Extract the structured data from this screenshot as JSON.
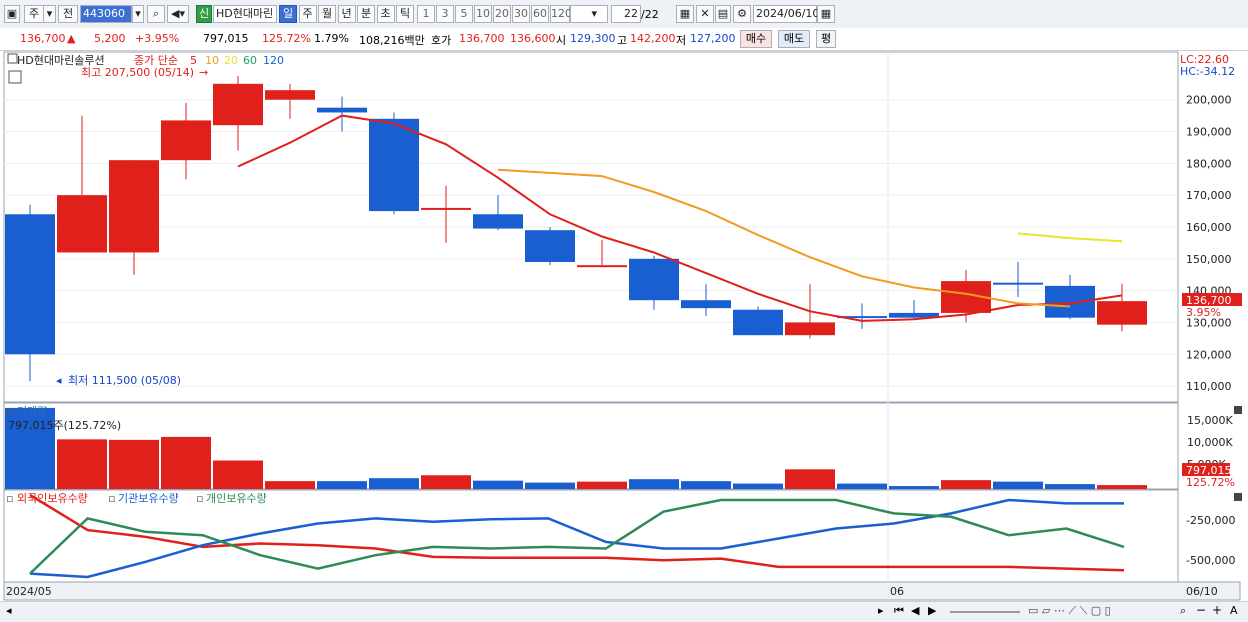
{
  "toolbar": {
    "stock_type": "주",
    "prev_label": "전",
    "code": "443060",
    "new_badge": "신",
    "stock_name": "HD현대마린",
    "periods": [
      "일",
      "주",
      "월",
      "년",
      "분",
      "초",
      "틱"
    ],
    "active_period": "일",
    "intervals": [
      "1",
      "3",
      "5",
      "10",
      "20",
      "30",
      "60",
      "120"
    ],
    "page_count": "22",
    "page_total": "/22",
    "date": "2024/06/10"
  },
  "quote": {
    "price": "136,700",
    "change": "5,200",
    "change_pct": "+3.95%",
    "volume": "797,015",
    "volume_ratio": "125.72%",
    "turnover": "1.79%",
    "amount": "108,216백만",
    "hoga_label": "호가",
    "ask": "136,700",
    "bid": "136,600",
    "open_label": "시",
    "open": "129,300",
    "high_label": "고",
    "high": "142,200",
    "low_label": "저",
    "low": "127,200",
    "buy_label": "매수",
    "sell_label": "매도",
    "avg_label": "평"
  },
  "price_chart": {
    "title": "HD현대마린솔루션",
    "ma_label": "종가 단순",
    "ma_periods": [
      "5",
      "10",
      "20",
      "60",
      "120"
    ],
    "ma_colors": [
      "#e0201b",
      "#f29a1f",
      "#e6e62a",
      "#2a9d5c",
      "#1a5fd1"
    ],
    "lc": "LC:22.60",
    "hc": "HC:-34.12",
    "high_note": "최고 207,500 (05/14)",
    "low_note": "최저 111,500 (05/08)",
    "last_price_tag": "136,700",
    "last_pct_tag": "3.95%",
    "y_ticks": [
      "200,000",
      "190,000",
      "180,000",
      "170,000",
      "160,000",
      "150,000",
      "140,000",
      "130,000",
      "120,000",
      "110,000"
    ]
  },
  "volume_chart": {
    "title": "거래량",
    "note": "797,015주(125.72%)",
    "y_ticks": [
      "15,000K",
      "10,000K",
      "5,000K"
    ],
    "last_tag": "797,015",
    "last_pct_tag": "125.72%"
  },
  "holdings_chart": {
    "legend": [
      "외국인보유수량",
      "기관보유수량",
      "개인보유수량"
    ],
    "colors": [
      "#e0201b",
      "#1a5fd1",
      "#2e8b57"
    ],
    "y_ticks": [
      "-250,000",
      "-500,000"
    ]
  },
  "x_axis": {
    "start": "2024/05",
    "mid": "06",
    "end": "06/10"
  },
  "chart_data": {
    "type": "candlestick",
    "y_range": [
      105000,
      215000
    ],
    "candles": [
      {
        "o": 164000,
        "h": 167000,
        "l": 111500,
        "c": 120000
      },
      {
        "o": 152000,
        "h": 195000,
        "l": 152000,
        "c": 170000
      },
      {
        "o": 152000,
        "h": 181000,
        "l": 145000,
        "c": 181000
      },
      {
        "o": 181000,
        "h": 199000,
        "l": 175000,
        "c": 193500
      },
      {
        "o": 192000,
        "h": 207500,
        "l": 184000,
        "c": 205000
      },
      {
        "o": 200000,
        "h": 205000,
        "l": 194000,
        "c": 203000
      },
      {
        "o": 197500,
        "h": 201000,
        "l": 190000,
        "c": 196000
      },
      {
        "o": 194000,
        "h": 196000,
        "l": 164000,
        "c": 165000
      },
      {
        "o": 166000,
        "h": 173000,
        "l": 155000,
        "c": 166000
      },
      {
        "o": 164000,
        "h": 170000,
        "l": 159000,
        "c": 159500
      },
      {
        "o": 159000,
        "h": 160000,
        "l": 148000,
        "c": 149000
      },
      {
        "o": 148000,
        "h": 156000,
        "l": 148000,
        "c": 148000
      },
      {
        "o": 150000,
        "h": 151000,
        "l": 134000,
        "c": 137000
      },
      {
        "o": 137000,
        "h": 142000,
        "l": 132000,
        "c": 134500
      },
      {
        "o": 134000,
        "h": 135000,
        "l": 126000,
        "c": 126000
      },
      {
        "o": 126000,
        "h": 142000,
        "l": 125000,
        "c": 130000
      },
      {
        "o": 132000,
        "h": 136000,
        "l": 128000,
        "c": 131500
      },
      {
        "o": 133000,
        "h": 137000,
        "l": 131000,
        "c": 131500
      },
      {
        "o": 133000,
        "h": 146500,
        "l": 130000,
        "c": 143000
      },
      {
        "o": 142500,
        "h": 149000,
        "l": 138000,
        "c": 142000
      },
      {
        "o": 141500,
        "h": 145000,
        "l": 131000,
        "c": 131500
      },
      {
        "o": 129300,
        "h": 142200,
        "l": 127200,
        "c": 136700
      }
    ],
    "ma5": [
      null,
      null,
      null,
      null,
      179000,
      186500,
      195000,
      192500,
      186000,
      175500,
      164000,
      157000,
      152000,
      145500,
      139000,
      133500,
      130500,
      131000,
      132500,
      135500,
      136000,
      138500
    ],
    "ma10": [
      null,
      null,
      null,
      null,
      null,
      null,
      null,
      null,
      null,
      178000,
      177000,
      176000,
      171000,
      165000,
      157500,
      150500,
      144500,
      141000,
      139000,
      136000,
      135000,
      null
    ],
    "ma20": [
      null,
      null,
      null,
      null,
      null,
      null,
      null,
      null,
      null,
      null,
      null,
      null,
      null,
      null,
      null,
      null,
      null,
      null,
      null,
      158000,
      156500,
      155500
    ],
    "volume": [
      16500,
      10100,
      10000,
      10600,
      5800,
      1600,
      1600,
      2200,
      2800,
      1700,
      1300,
      1500,
      2000,
      1600,
      1100,
      4000,
      1100,
      600,
      1800,
      1500,
      1000,
      797
    ],
    "foreign": [
      -130000,
      -340000,
      -380000,
      -440000,
      -420000,
      -430000,
      -450000,
      -500000,
      -505000,
      -505000,
      -505000,
      -520000,
      -510000,
      -560000,
      -560000,
      -560000,
      -560000,
      -560000,
      -570000,
      -580000
    ],
    "institution": [
      -600000,
      -620000,
      -530000,
      -430000,
      -360000,
      -300000,
      -270000,
      -290000,
      -275000,
      -270000,
      -410000,
      -450000,
      -450000,
      -390000,
      -330000,
      -300000,
      -240000,
      -160000,
      -180000,
      -180000
    ],
    "individual": [
      -600000,
      -270000,
      -350000,
      -370000,
      -490000,
      -570000,
      -490000,
      -440000,
      -450000,
      -440000,
      -450000,
      -230000,
      -160000,
      -160000,
      -160000,
      -240000,
      -260000,
      -370000,
      -330000,
      -440000
    ],
    "holdings_range": [
      -650000,
      -100000
    ]
  }
}
